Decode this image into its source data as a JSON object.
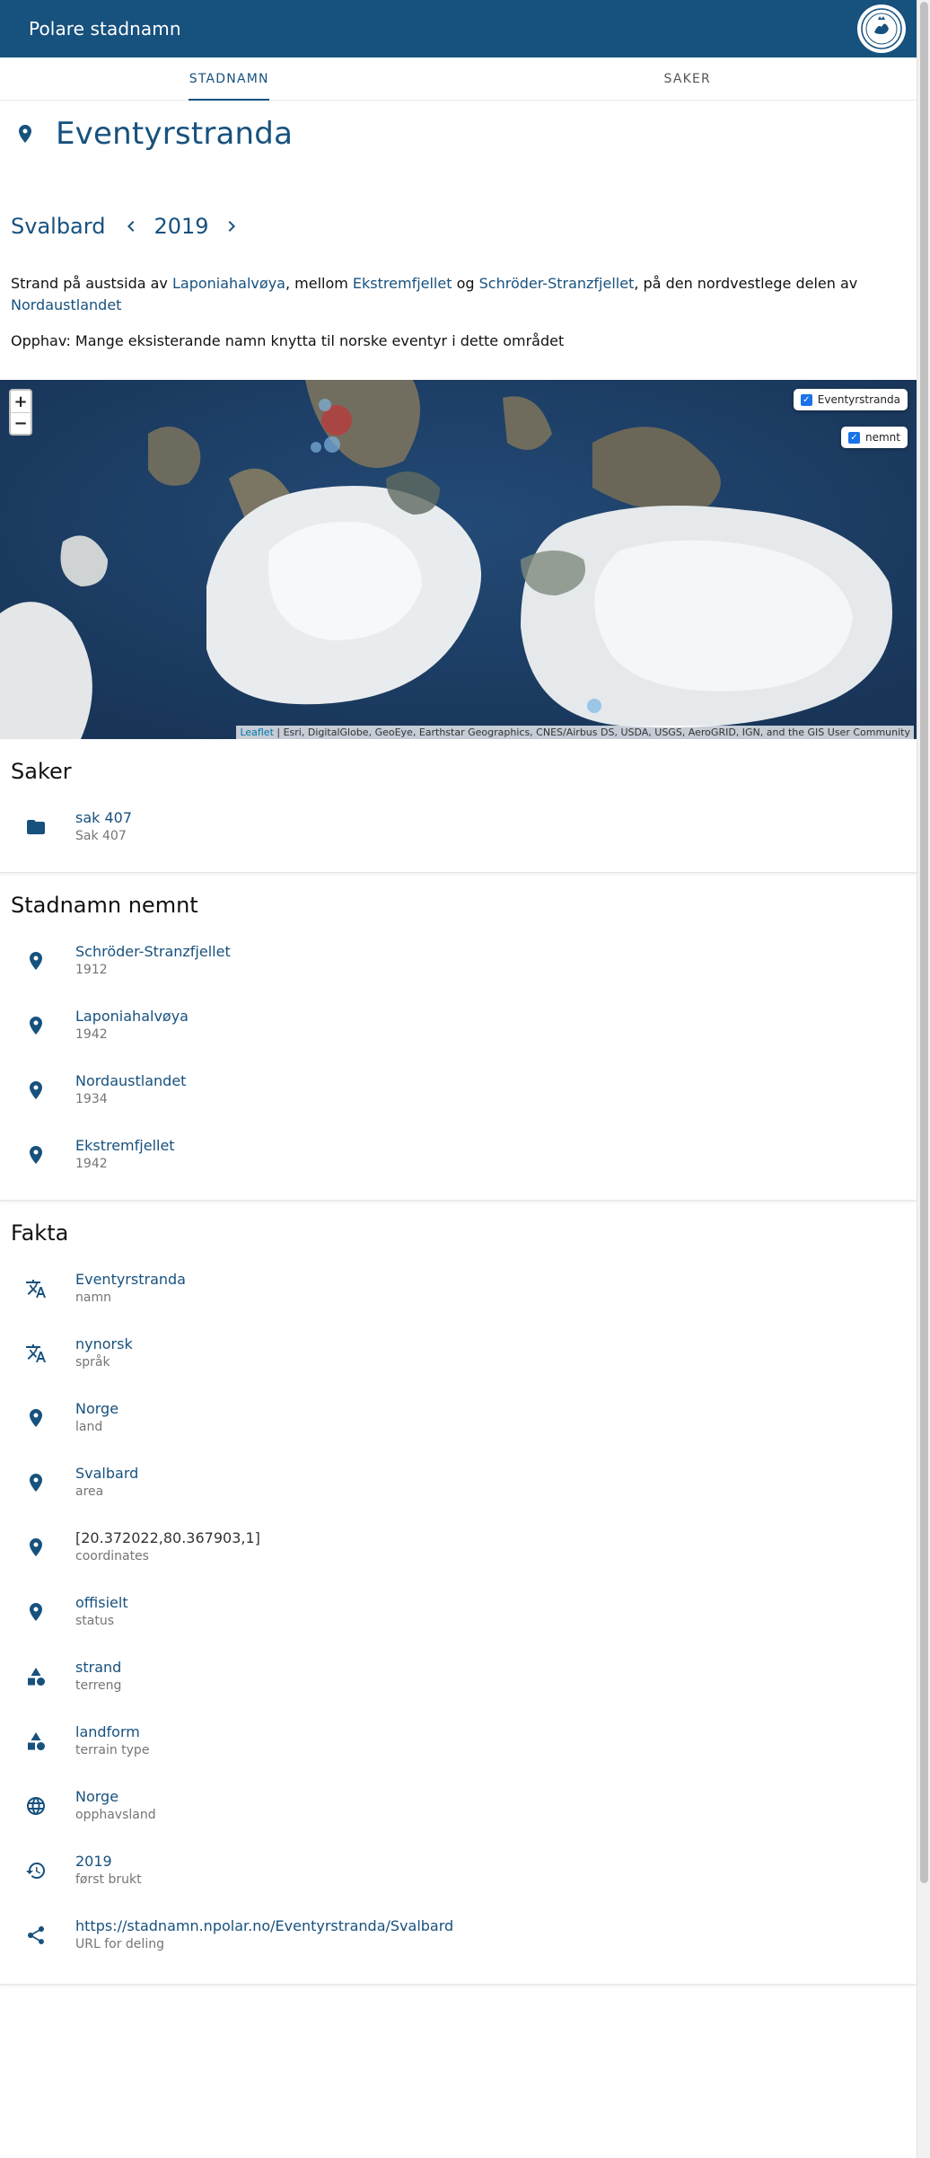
{
  "app": {
    "title": "Polare stadnamn",
    "logo_icon": "norwegian-polar-institute-seal"
  },
  "tabs": [
    {
      "label": "STADNAMN",
      "active": true
    },
    {
      "label": "SAKER",
      "active": false
    }
  ],
  "place": {
    "name": "Eventyrstranda",
    "area": "Svalbard",
    "year": "2019",
    "description": {
      "p1": "Strand på austsida av ",
      "link1": "Laponiahalvøya",
      "p2": ", mellom ",
      "link2": "Ekstremfjellet",
      "p3": " og ",
      "link3": "Schröder-Stranzfjellet",
      "p4": ", på den nordvestlege delen av ",
      "link4": "Nordaustlandet"
    },
    "origin": "Opphav: Mange eksisterande namn knytta til norske eventyr i dette området"
  },
  "map": {
    "zoom_in": "+",
    "zoom_out": "−",
    "layers": [
      {
        "label": "Eventyrstranda",
        "checked": true
      },
      {
        "label": "nemnt",
        "checked": true
      }
    ],
    "attribution_link": "Leaflet",
    "attribution_text": " | Esri, DigitalGlobe, GeoEye, Earthstar Geographics, CNES/Airbus DS, USDA, USGS, AeroGRID, IGN, and the GIS User Community"
  },
  "saker": {
    "heading": "Saker",
    "items": [
      {
        "primary": "sak 407",
        "secondary": "Sak 407",
        "icon": "folder-icon"
      }
    ]
  },
  "nemnt": {
    "heading": "Stadnamn nemnt",
    "items": [
      {
        "primary": "Schröder-Stranzfjellet",
        "secondary": "1912",
        "icon": "place-icon"
      },
      {
        "primary": "Laponiahalvøya",
        "secondary": "1942",
        "icon": "place-icon"
      },
      {
        "primary": "Nordaustlandet",
        "secondary": "1934",
        "icon": "place-icon"
      },
      {
        "primary": "Ekstremfjellet",
        "secondary": "1942",
        "icon": "place-icon"
      }
    ]
  },
  "fakta": {
    "heading": "Fakta",
    "items": [
      {
        "primary": "Eventyrstranda",
        "secondary": "namn",
        "icon": "translate-icon"
      },
      {
        "primary": "nynorsk",
        "secondary": "språk",
        "icon": "translate-icon"
      },
      {
        "primary": "Norge",
        "secondary": "land",
        "icon": "place-icon"
      },
      {
        "primary": "Svalbard",
        "secondary": "area",
        "icon": "place-icon"
      },
      {
        "primary": "[20.372022,80.367903,1]",
        "secondary": "coordinates",
        "icon": "place-icon"
      },
      {
        "primary": "offisielt",
        "secondary": "status",
        "icon": "place-icon"
      },
      {
        "primary": "strand",
        "secondary": "terreng",
        "icon": "category-icon"
      },
      {
        "primary": "landform",
        "secondary": "terrain type",
        "icon": "category-icon"
      },
      {
        "primary": "Norge",
        "secondary": "opphavsland",
        "icon": "globe-icon"
      },
      {
        "primary": "2019",
        "secondary": "først brukt",
        "icon": "history-icon"
      },
      {
        "primary": "https://stadnamn.npolar.no/Eventyrstranda/Svalbard",
        "secondary": "URL for deling",
        "icon": "share-icon"
      }
    ]
  },
  "colors": {
    "primary": "#17517e",
    "secondary_text": "#757575"
  }
}
